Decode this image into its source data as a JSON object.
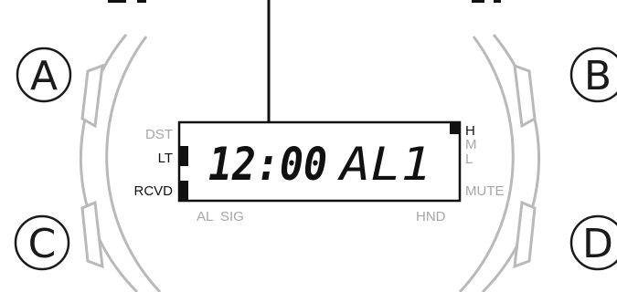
{
  "buttons": {
    "a": "A",
    "b": "B",
    "c": "C",
    "d": "D"
  },
  "indicators": {
    "dst": "DST",
    "lt": "LT",
    "rcvd": "RCVD",
    "al": "AL",
    "sig": "SIG",
    "hnd": "HND",
    "h": "H",
    "m": "M",
    "l": "L",
    "mute": "MUTE"
  },
  "display": {
    "time": "12:00",
    "mode": "AL1"
  },
  "colors": {
    "bezel": "#b9b9b9",
    "active_text": "#111111",
    "inactive_text": "#a6a6a6"
  }
}
